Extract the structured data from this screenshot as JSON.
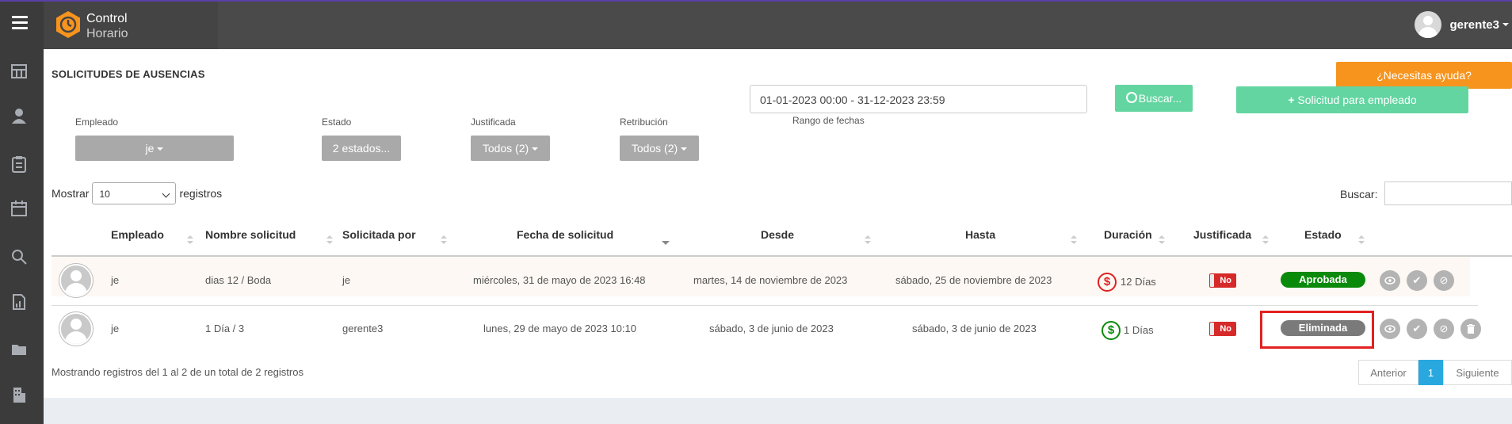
{
  "app": {
    "brand_line1": "Control",
    "brand_line2": "Horario",
    "user_name": "gerente3"
  },
  "sidebar_icons": [
    "dashboard-icon",
    "user-icon",
    "clipboard-icon",
    "calendar-icon",
    "search-icon",
    "report-icon",
    "folder-icon",
    "building-icon"
  ],
  "page": {
    "title": "SOLICITUDES DE AUSENCIAS",
    "help_button": "¿Necesitas ayuda?"
  },
  "filters": {
    "empleado_label": "Empleado",
    "empleado_value": "je",
    "estado_label": "Estado",
    "estado_value": "2 estados...",
    "justificada_label": "Justificada",
    "justificada_value": "Todos (2)",
    "retribucion_label": "Retribución",
    "retribucion_value": "Todos (2)",
    "rango_label": "Rango de fechas",
    "rango_value": "01-01-2023 00:00 - 31-12-2023 23:59",
    "search_button": "Buscar...",
    "new_button": "Solicitud para empleado"
  },
  "table_controls": {
    "show_label": "Mostrar",
    "show_value": "10",
    "records_label": "registros",
    "search_label": "Buscar:"
  },
  "columns": [
    "Empleado",
    "Nombre solicitud",
    "Solicitada por",
    "Fecha de solicitud",
    "Desde",
    "Hasta",
    "Duración",
    "Justificada",
    "Estado"
  ],
  "rows": [
    {
      "empleado": "je",
      "nombre": "dias 12 / Boda",
      "solicitada_por": "je",
      "fecha": "miércoles, 31 de mayo de 2023 16:48",
      "desde": "martes, 14 de noviembre de 2023",
      "hasta": "sábado, 25 de noviembre de 2023",
      "duracion": "12 Días",
      "justificada": "No",
      "estado": "Aprobada",
      "money_color": "#e02020",
      "estado_color": "#0a8a0a"
    },
    {
      "empleado": "je",
      "nombre": "1 Día / 3",
      "solicitada_por": "gerente3",
      "fecha": "lunes, 29 de mayo de 2023 10:10",
      "desde": "sábado, 3 de junio de 2023",
      "hasta": "sábado, 3 de junio de 2023",
      "duracion": "1 Días",
      "justificada": "No",
      "estado": "Eliminada",
      "money_color": "#0a8a0a",
      "estado_color": "#7a7a7a"
    }
  ],
  "footer": {
    "info": "Mostrando registros del 1 al 2 de un total de 2 registros",
    "prev": "Anterior",
    "page": "1",
    "next": "Siguiente"
  }
}
